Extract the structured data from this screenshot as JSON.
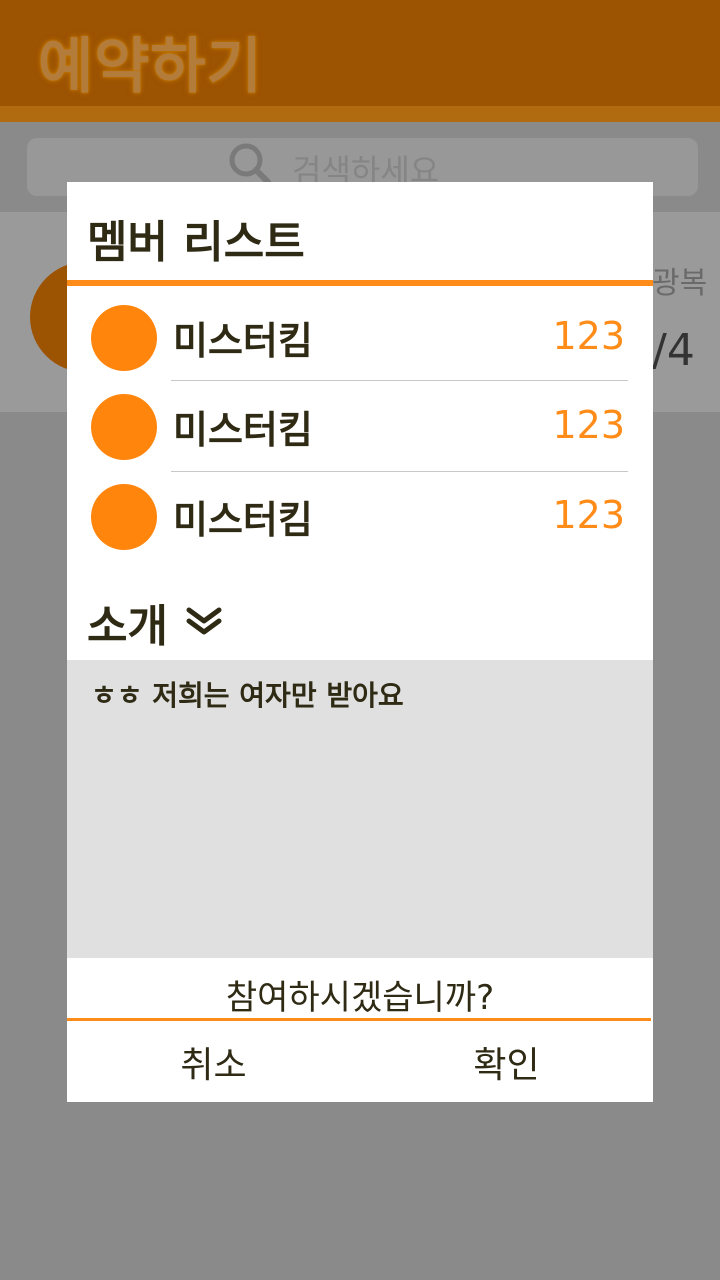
{
  "app": {
    "title": "예약하기",
    "search_placeholder": "검색하세요",
    "bg_card": {
      "top_text": "광복",
      "count_text": "/4"
    }
  },
  "dialog": {
    "title": "멤버 리스트",
    "members": [
      {
        "name": "미스터킴",
        "score": "123"
      },
      {
        "name": "미스터킴",
        "score": "123"
      },
      {
        "name": "미스터킴",
        "score": "123"
      }
    ],
    "intro_label": "소개",
    "intro_icon": "double-chevron-down-icon",
    "intro_text": "ㅎㅎ 저희는 여자만 받아요",
    "question": "참여하시겠습니까?",
    "cancel_label": "취소",
    "ok_label": "확인"
  },
  "colors": {
    "accent": "#ff8c18",
    "header_dim": "#9c5302",
    "overlay": "#8a8a8a",
    "text_dark": "#2e2a14"
  }
}
